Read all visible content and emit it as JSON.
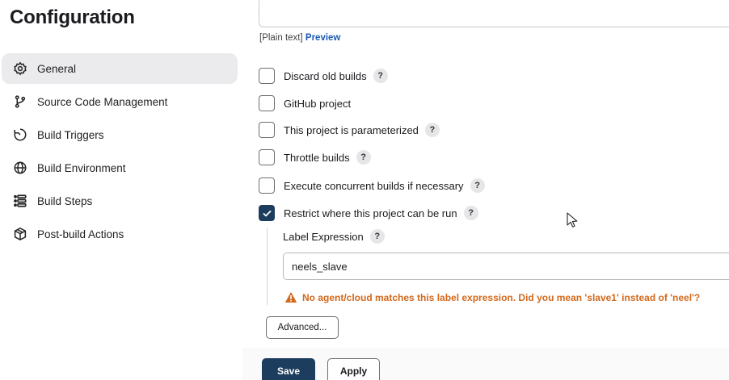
{
  "page": {
    "title": "Configuration"
  },
  "sidebar": {
    "items": [
      {
        "label": "General",
        "icon": "gear-icon",
        "active": true
      },
      {
        "label": "Source Code Management",
        "icon": "branch-icon",
        "active": false
      },
      {
        "label": "Build Triggers",
        "icon": "timer-icon",
        "active": false
      },
      {
        "label": "Build Environment",
        "icon": "globe-icon",
        "active": false
      },
      {
        "label": "Build Steps",
        "icon": "steps-list-icon",
        "active": false
      },
      {
        "label": "Post-build Actions",
        "icon": "package-icon",
        "active": false
      }
    ]
  },
  "description": {
    "format_text": "[Plain text]",
    "preview_label": "Preview"
  },
  "options": [
    {
      "label": "Discard old builds",
      "checked": false
    },
    {
      "label": "GitHub project",
      "checked": false
    },
    {
      "label": "This project is parameterized",
      "checked": false
    },
    {
      "label": "Throttle builds",
      "checked": false
    },
    {
      "label": "Execute concurrent builds if necessary",
      "checked": false
    },
    {
      "label": "Restrict where this project can be run",
      "checked": true
    }
  ],
  "help_label": "?",
  "restrict": {
    "label_expression_label": "Label Expression",
    "label_expression_value": "neels_slave",
    "warning": "No agent/cloud matches this label expression. Did you mean 'slave1' instead of 'neel'?"
  },
  "buttons": {
    "advanced": "Advanced...",
    "save": "Save",
    "apply": "Apply"
  },
  "colors": {
    "primary": "#1d3d5e",
    "warning": "#d3691c",
    "link": "#1a5ab4"
  }
}
